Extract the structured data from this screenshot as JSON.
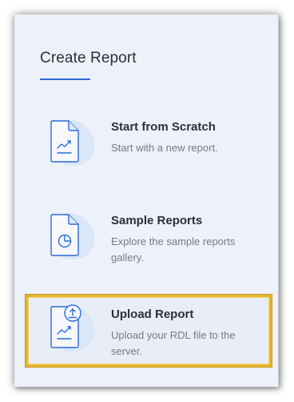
{
  "panel": {
    "title": "Create Report"
  },
  "options": [
    {
      "title": "Start from Scratch",
      "description": "Start with a new report.",
      "icon": "document-chart-icon"
    },
    {
      "title": "Sample Reports",
      "description": "Explore the sample reports gallery.",
      "icon": "document-pie-icon"
    },
    {
      "title": "Upload Report",
      "description": "Upload your RDL file to the server.",
      "icon": "document-upload-icon",
      "highlighted": true
    }
  ],
  "colors": {
    "accent": "#2d6bd6",
    "panel_background": "#edf1fa",
    "highlight_border": "#e4b52f",
    "title_text": "#2b2f38",
    "description_text": "#777b84"
  }
}
